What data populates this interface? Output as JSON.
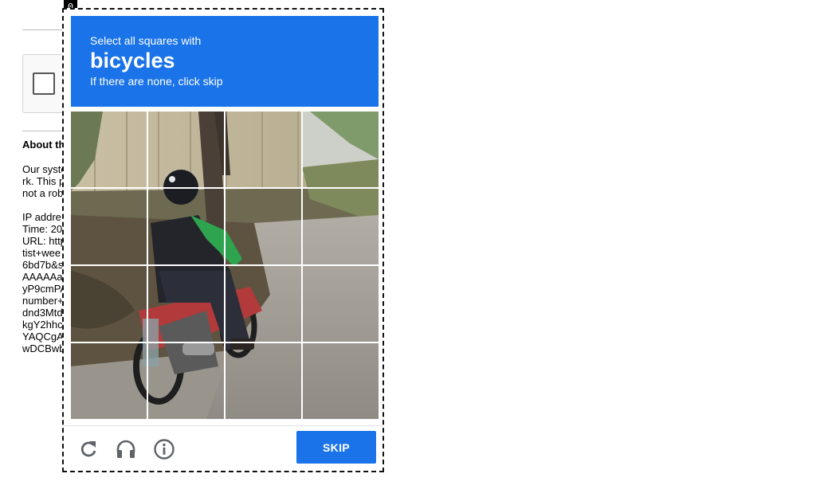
{
  "background_page": {
    "about_heading": "About th",
    "paragraph_lines": [
      "Our syste",
      "rk. This p",
      "not a rob"
    ],
    "info_lines": [
      "IP addre",
      "Time: 20",
      "URL: http",
      "tist+wee",
      "6bd7b&s",
      "AAAAAa",
      "yP9cmPA",
      "number+",
      "dnd3Mtd",
      "kgY2hhc",
      "YAQCgA",
      "wDCBwb"
    ]
  },
  "challenge": {
    "frame_index": "0",
    "instruction_line1": "Select all squares with",
    "keyword": "bicycles",
    "instruction_line3": "If there are none, click skip",
    "grid_size": 4,
    "colors": {
      "accent": "#1a73e8",
      "icon_gray": "#5f6368"
    },
    "controls": {
      "reload_icon": "reload-icon",
      "audio_icon": "headphones-icon",
      "info_icon": "info-icon",
      "skip_label": "SKIP"
    }
  }
}
